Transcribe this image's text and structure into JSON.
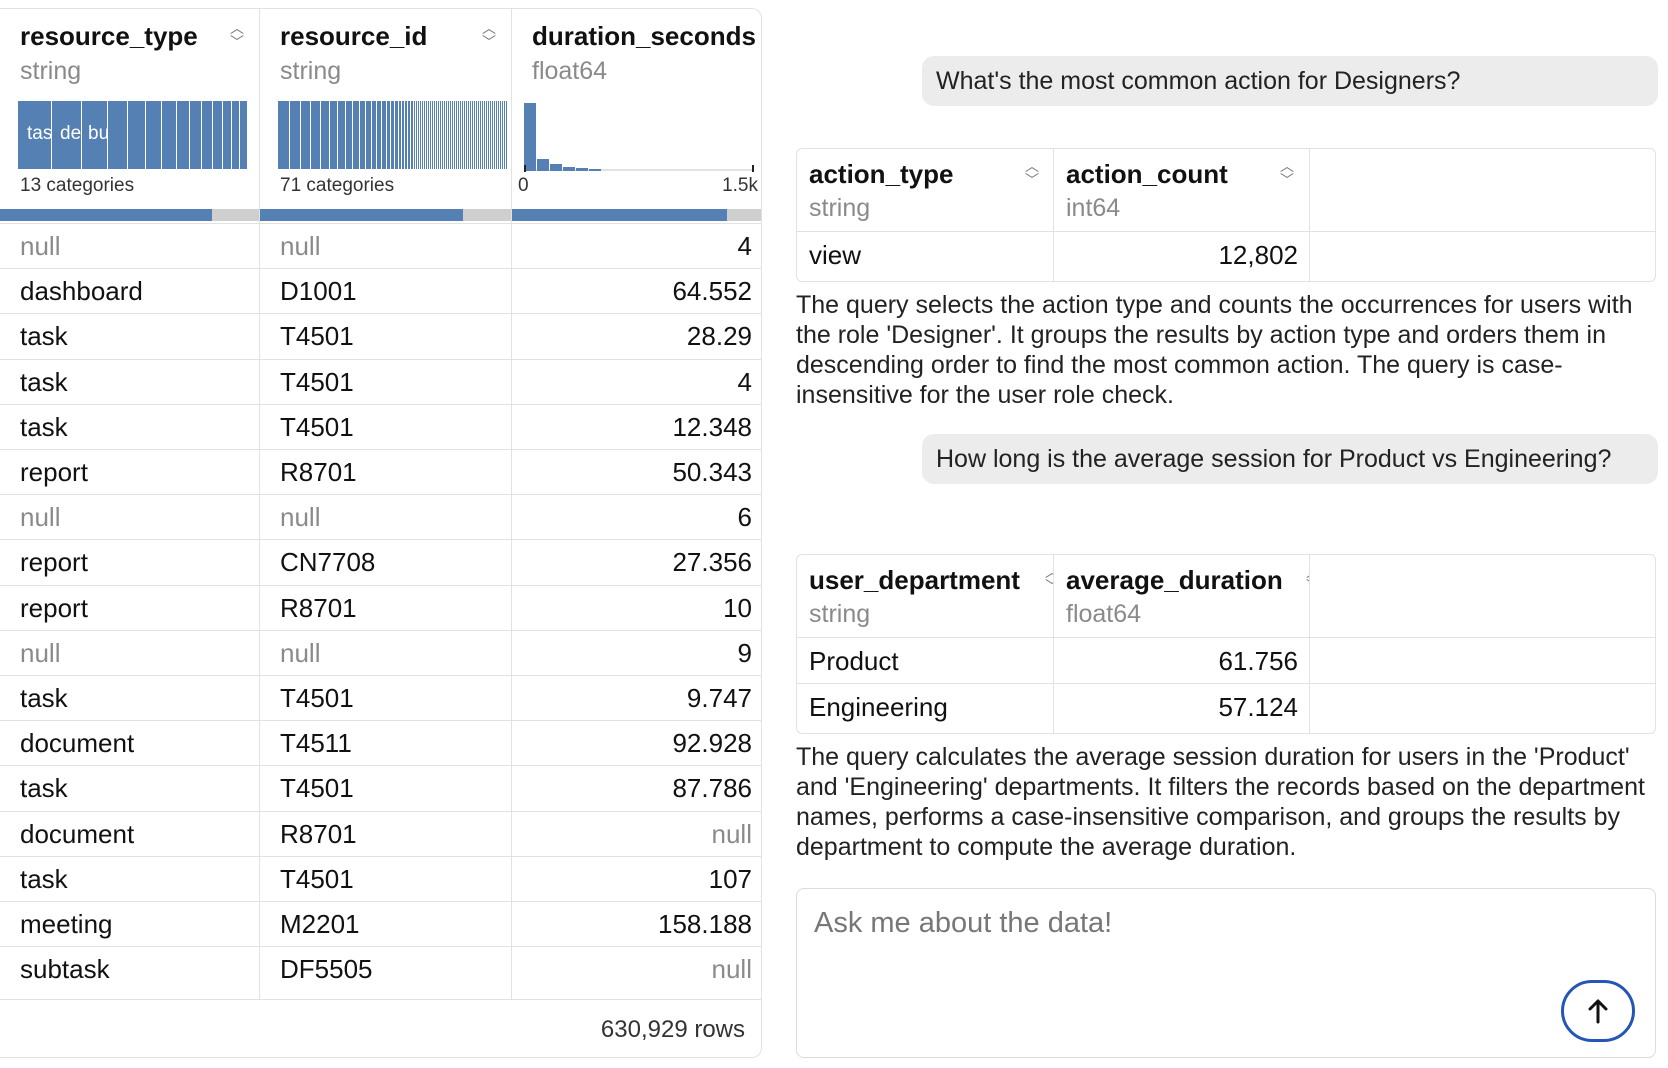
{
  "grid": {
    "columns": [
      {
        "name": "resource_type",
        "type": "string",
        "summary": "13 categories",
        "hist_labels": [
          "tas",
          "de",
          "bu"
        ],
        "valid_fraction": 0.82
      },
      {
        "name": "resource_id",
        "type": "string",
        "summary": "71 categories",
        "valid_fraction": 0.81
      },
      {
        "name": "duration_seconds",
        "type": "float64",
        "axis_min": "0",
        "axis_max": "1.5k",
        "valid_fraction": 0.86
      }
    ],
    "rows": [
      [
        "null",
        "null",
        "4"
      ],
      [
        "dashboard",
        "D1001",
        "64.552"
      ],
      [
        "task",
        "T4501",
        "28.29"
      ],
      [
        "task",
        "T4501",
        "4"
      ],
      [
        "task",
        "T4501",
        "12.348"
      ],
      [
        "report",
        "R8701",
        "50.343"
      ],
      [
        "null",
        "null",
        "6"
      ],
      [
        "report",
        "CN7708",
        "27.356"
      ],
      [
        "report",
        "R8701",
        "10"
      ],
      [
        "null",
        "null",
        "9"
      ],
      [
        "task",
        "T4501",
        "9.747"
      ],
      [
        "document",
        "T4511",
        "92.928"
      ],
      [
        "task",
        "T4501",
        "87.786"
      ],
      [
        "document",
        "R8701",
        "null"
      ],
      [
        "task",
        "T4501",
        "107"
      ],
      [
        "meeting",
        "M2201",
        "158.188"
      ],
      [
        "subtask",
        "DF5505",
        "null"
      ]
    ],
    "row_count": "630,929 rows"
  },
  "chat": {
    "q1": "What's the most common action for Designers?",
    "t1": {
      "columns": [
        {
          "name": "action_type",
          "type": "string"
        },
        {
          "name": "action_count",
          "type": "int64"
        }
      ],
      "rows": [
        [
          "view",
          "12,802"
        ]
      ]
    },
    "a1": "The query selects the action type and counts the occurrences for users with the role 'Designer'. It groups the results by action type and orders them in descending order to find the most common action. The query is case-insensitive for the user role check.",
    "q2": "How long is the average session for Product vs Engineering?",
    "t2": {
      "columns": [
        {
          "name": "user_department",
          "type": "string"
        },
        {
          "name": "average_duration",
          "type": "float64"
        }
      ],
      "rows": [
        [
          "Product",
          "61.756"
        ],
        [
          "Engineering",
          "57.124"
        ]
      ]
    },
    "a2": "The query calculates the average session duration for users in the 'Product' and 'Engineering' departments. It filters the records based on the department names, performs a case-insensitive comparison, and groups the results by department to compute the average duration.",
    "input_placeholder": "Ask me about the data!",
    "send_icon": "arrow-up-icon"
  },
  "colors": {
    "accent": "#5580b3",
    "null_text": "#8a8a8a",
    "send_border": "#2456b6"
  }
}
